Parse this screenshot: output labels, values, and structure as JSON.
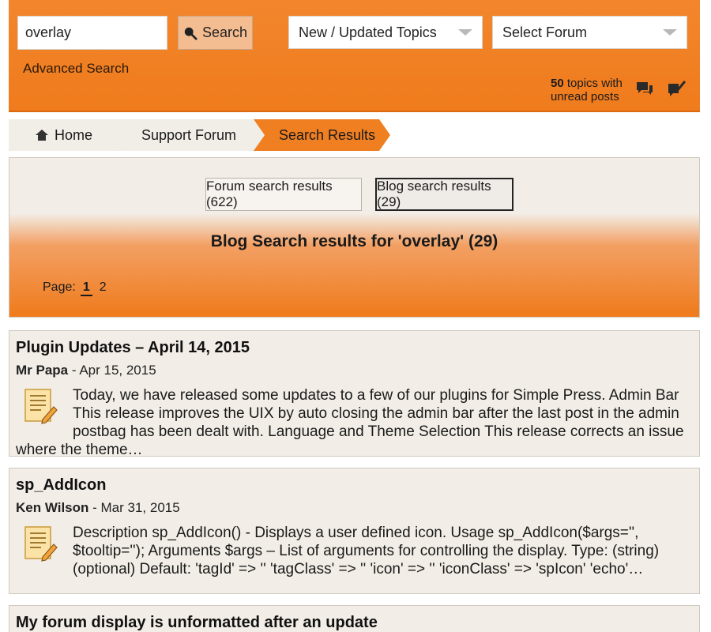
{
  "header": {
    "search_value": "overlay",
    "search_label": "Search",
    "topics_select": "New / Updated Topics",
    "forum_select": "Select Forum",
    "advanced_search": "Advanced Search",
    "unread_count": "50",
    "unread_text": "topics with",
    "unread_text2": "unread posts"
  },
  "breadcrumb": {
    "home": "Home",
    "forum": "Support Forum",
    "results": "Search Results"
  },
  "results": {
    "forum_tab": "Forum search results (622)",
    "blog_tab": "Blog search results (29)",
    "title": "Blog Search results for 'overlay' (29)",
    "page_label": "Page:",
    "pages": [
      "1",
      "2"
    ]
  },
  "posts": [
    {
      "title": "Plugin Updates – April 14, 2015",
      "author": "Mr Papa",
      "date": "- Apr 15, 2015",
      "excerpt": "Today, we have released some updates to a few of our plugins for Simple Press. Admin Bar This release improves the UIX by auto closing the admin bar after the last post in the admin postbag has been dealt with. Language and Theme Selection This release corrects an issue where the theme…"
    },
    {
      "title": "sp_AddIcon",
      "author": "Ken Wilson",
      "date": "- Mar 31, 2015",
      "excerpt": "Description sp_AddIcon() - Displays a user defined icon. Usage sp_AddIcon($args='', $tooltip=''); Arguments $args – List of arguments for controlling the display. Type: (string) (optional) Default: 'tagId' => '' 'tagClass' => '' 'icon' => '' 'iconClass' => 'spIcon' 'echo'…"
    },
    {
      "title": "My forum display is unformatted after an update"
    }
  ],
  "colors": {
    "accent": "#ef7b1c",
    "panel": "#f2eee7"
  }
}
